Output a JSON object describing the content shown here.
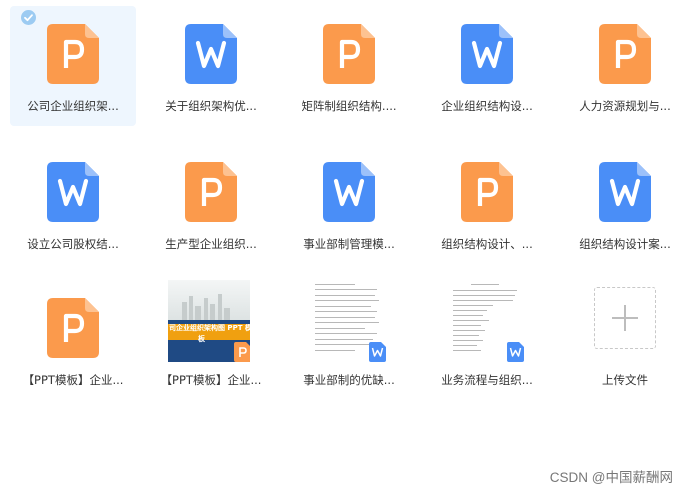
{
  "colors": {
    "ppt": "#fb9a4c",
    "word": "#4a8ef7",
    "selected_bg": "#eef6fe",
    "check": "#9ccbf2"
  },
  "files": [
    {
      "name": "公司企业组织架...",
      "type": "ppt",
      "selected": true
    },
    {
      "name": "关于组织架构优...",
      "type": "word"
    },
    {
      "name": "矩阵制组织结构....",
      "type": "ppt"
    },
    {
      "name": "企业组织结构设...",
      "type": "word"
    },
    {
      "name": "人力资源规划与...",
      "type": "ppt"
    },
    {
      "name": "设立公司股权结...",
      "type": "word"
    },
    {
      "name": "生产型企业组织...",
      "type": "ppt"
    },
    {
      "name": "事业部制管理模...",
      "type": "word"
    },
    {
      "name": "组织结构设计、...",
      "type": "ppt"
    },
    {
      "name": "组织结构设计案...",
      "type": "word"
    },
    {
      "name": "【PPT模板】企业...",
      "type": "ppt"
    },
    {
      "name": "【PPT模板】企业...",
      "type": "ppt-thumb",
      "thumb_title": "司企业组织架构图 PPT 模",
      "thumb_sub": "板"
    },
    {
      "name": "事业部制的优缺...",
      "type": "doc-thumb"
    },
    {
      "name": "业务流程与组织...",
      "type": "doc-thumb"
    }
  ],
  "upload": {
    "label": "上传文件"
  },
  "watermark": "CSDN @中国薪酬网"
}
